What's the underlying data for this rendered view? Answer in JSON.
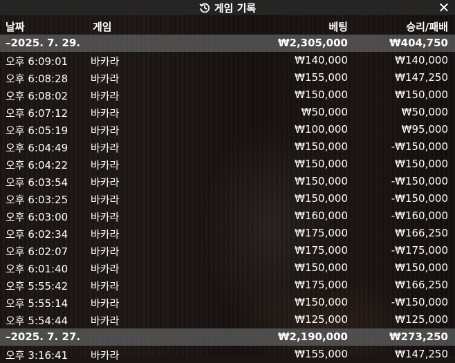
{
  "title": "게임 기록",
  "icons": {
    "history": "history-icon",
    "close": "close-icon"
  },
  "columns": {
    "date": "날짜",
    "game": "게임",
    "bet": "베팅",
    "result": "승리/패배"
  },
  "groups": [
    {
      "date": "–2025. 7. 29.",
      "total_bet": "₩2,305,000",
      "total_result": "₩404,750",
      "rows": [
        {
          "time": "오후 6:09:01",
          "game": "바카라",
          "bet": "₩140,000",
          "result": "₩140,000"
        },
        {
          "time": "오후 6:08:28",
          "game": "바카라",
          "bet": "₩155,000",
          "result": "₩147,250"
        },
        {
          "time": "오후 6:08:02",
          "game": "바카라",
          "bet": "₩150,000",
          "result": "₩150,000"
        },
        {
          "time": "오후 6:07:12",
          "game": "바카라",
          "bet": "₩50,000",
          "result": "₩50,000"
        },
        {
          "time": "오후 6:05:19",
          "game": "바카라",
          "bet": "₩100,000",
          "result": "₩95,000"
        },
        {
          "time": "오후 6:04:49",
          "game": "바카라",
          "bet": "₩150,000",
          "result": "-₩150,000"
        },
        {
          "time": "오후 6:04:22",
          "game": "바카라",
          "bet": "₩150,000",
          "result": "₩150,000"
        },
        {
          "time": "오후 6:03:54",
          "game": "바카라",
          "bet": "₩150,000",
          "result": "-₩150,000"
        },
        {
          "time": "오후 6:03:25",
          "game": "바카라",
          "bet": "₩150,000",
          "result": "-₩150,000"
        },
        {
          "time": "오후 6:03:00",
          "game": "바카라",
          "bet": "₩160,000",
          "result": "-₩160,000"
        },
        {
          "time": "오후 6:02:34",
          "game": "바카라",
          "bet": "₩175,000",
          "result": "₩166,250"
        },
        {
          "time": "오후 6:02:07",
          "game": "바카라",
          "bet": "₩175,000",
          "result": "-₩175,000"
        },
        {
          "time": "오후 6:01:40",
          "game": "바카라",
          "bet": "₩150,000",
          "result": "₩150,000"
        },
        {
          "time": "오후 5:55:42",
          "game": "바카라",
          "bet": "₩175,000",
          "result": "₩166,250"
        },
        {
          "time": "오후 5:55:14",
          "game": "바카라",
          "bet": "₩150,000",
          "result": "-₩150,000"
        },
        {
          "time": "오후 5:54:44",
          "game": "바카라",
          "bet": "₩125,000",
          "result": "₩125,000"
        }
      ]
    },
    {
      "date": "–2025. 7. 27.",
      "total_bet": "₩2,190,000",
      "total_result": "₩273,250",
      "rows": [
        {
          "time": "오후 3:16:41",
          "game": "바카라",
          "bet": "₩155,000",
          "result": "₩147,250"
        }
      ]
    }
  ]
}
